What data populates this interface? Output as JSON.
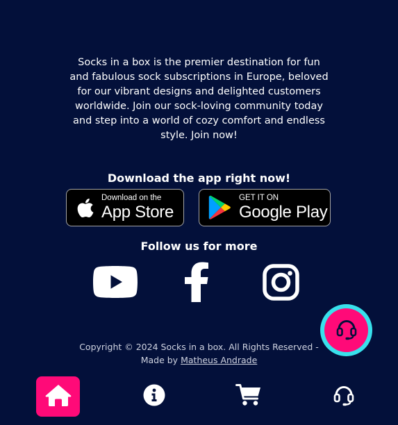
{
  "about": {
    "text": "Socks in a box is the premier destination for fun and fabulous sock subscriptions in Europe, beloved for our vibrant designs and delighted customers worldwide. Join our sock-loving community today and step into a world of cozy comfort and endless style. Join now!"
  },
  "download": {
    "title": "Download the app right now!",
    "app_store": {
      "small": "Download on the",
      "big": "App Store",
      "icon": "apple-icon"
    },
    "google_play": {
      "small": "GET IT ON",
      "big": "Google Play",
      "icon": "google-play-icon"
    }
  },
  "social": {
    "title": "Follow us for more",
    "items": [
      {
        "name": "YouTube",
        "icon": "youtube-icon"
      },
      {
        "name": "Facebook",
        "icon": "facebook-icon"
      },
      {
        "name": "Instagram",
        "icon": "instagram-icon"
      }
    ]
  },
  "footer": {
    "copyright": "Copyright © 2024 Socks in a box. All Rights Reserved - Made by",
    "author": "Matheus Andrade"
  },
  "fab": {
    "icon": "headset-icon"
  },
  "bottom_nav": {
    "items": [
      {
        "icon": "home-icon",
        "active": true
      },
      {
        "icon": "info-icon",
        "active": false
      },
      {
        "icon": "cart-icon",
        "active": false
      },
      {
        "icon": "headset-icon",
        "active": false
      }
    ]
  },
  "colors": {
    "background": "#03103a",
    "accent": "#ff0a78",
    "fab_ring": "#38e1ec",
    "text": "#ffffff"
  }
}
